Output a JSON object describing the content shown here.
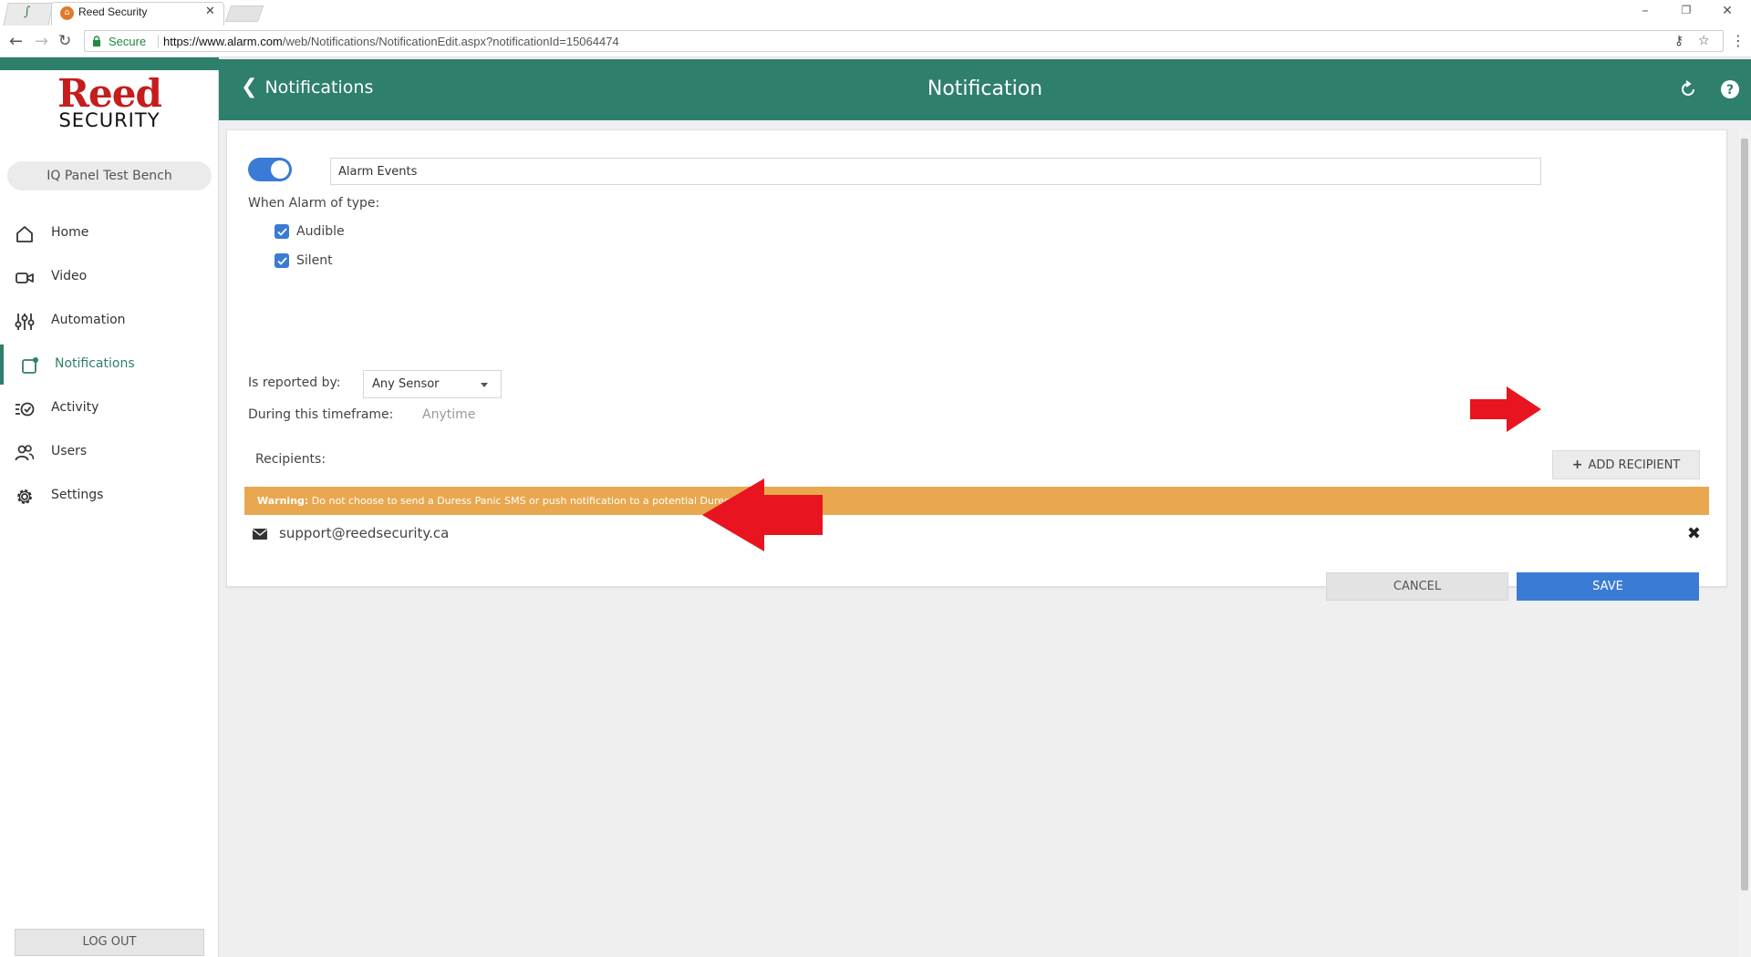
{
  "browser": {
    "tab_title": "Reed Security",
    "secure_label": "Secure",
    "url_domain": "https://www.alarm.com",
    "url_path": "/web/Notifications/NotificationEdit.aspx?notificationId=15064474"
  },
  "logo": {
    "top": "Reed",
    "bottom": "SECURITY"
  },
  "system_name": "IQ Panel Test Bench",
  "sidebar": {
    "items": [
      {
        "label": "Home",
        "icon": "home-icon"
      },
      {
        "label": "Video",
        "icon": "video-camera-icon"
      },
      {
        "label": "Automation",
        "icon": "sliders-icon"
      },
      {
        "label": "Notifications",
        "icon": "notification-icon",
        "active": true
      },
      {
        "label": "Activity",
        "icon": "activity-icon"
      },
      {
        "label": "Users",
        "icon": "users-icon"
      },
      {
        "label": "Settings",
        "icon": "gear-icon"
      }
    ],
    "logout_label": "LOG OUT"
  },
  "header": {
    "back_label": "Notifications",
    "title": "Notification"
  },
  "form": {
    "enabled": true,
    "name_value": "Alarm Events",
    "alarm_type_label": "When Alarm of type:",
    "alarm_types": [
      {
        "label": "Audible",
        "checked": true
      },
      {
        "label": "Silent",
        "checked": true
      }
    ],
    "reported_by_label": "Is reported by:",
    "reported_by_value": "Any Sensor",
    "timeframe_label": "During this timeframe:",
    "timeframe_value": "Anytime",
    "recipients_label": "Recipients:",
    "add_recipient_label": "ADD RECIPIENT",
    "warning_bold": "Warning:",
    "warning_text": " Do not choose to send a Duress Panic SMS or push notification to a potential Duress Code user.",
    "recipients": [
      {
        "email": "support@reedsecurity.ca"
      }
    ],
    "cancel_label": "CANCEL",
    "save_label": "SAVE"
  },
  "colors": {
    "brand_green": "#2f7f6d",
    "primary_blue": "#3a7bd5",
    "warning_orange": "#e9a84f",
    "logo_red": "#c51c1c",
    "annotation_red": "#e8141f"
  }
}
